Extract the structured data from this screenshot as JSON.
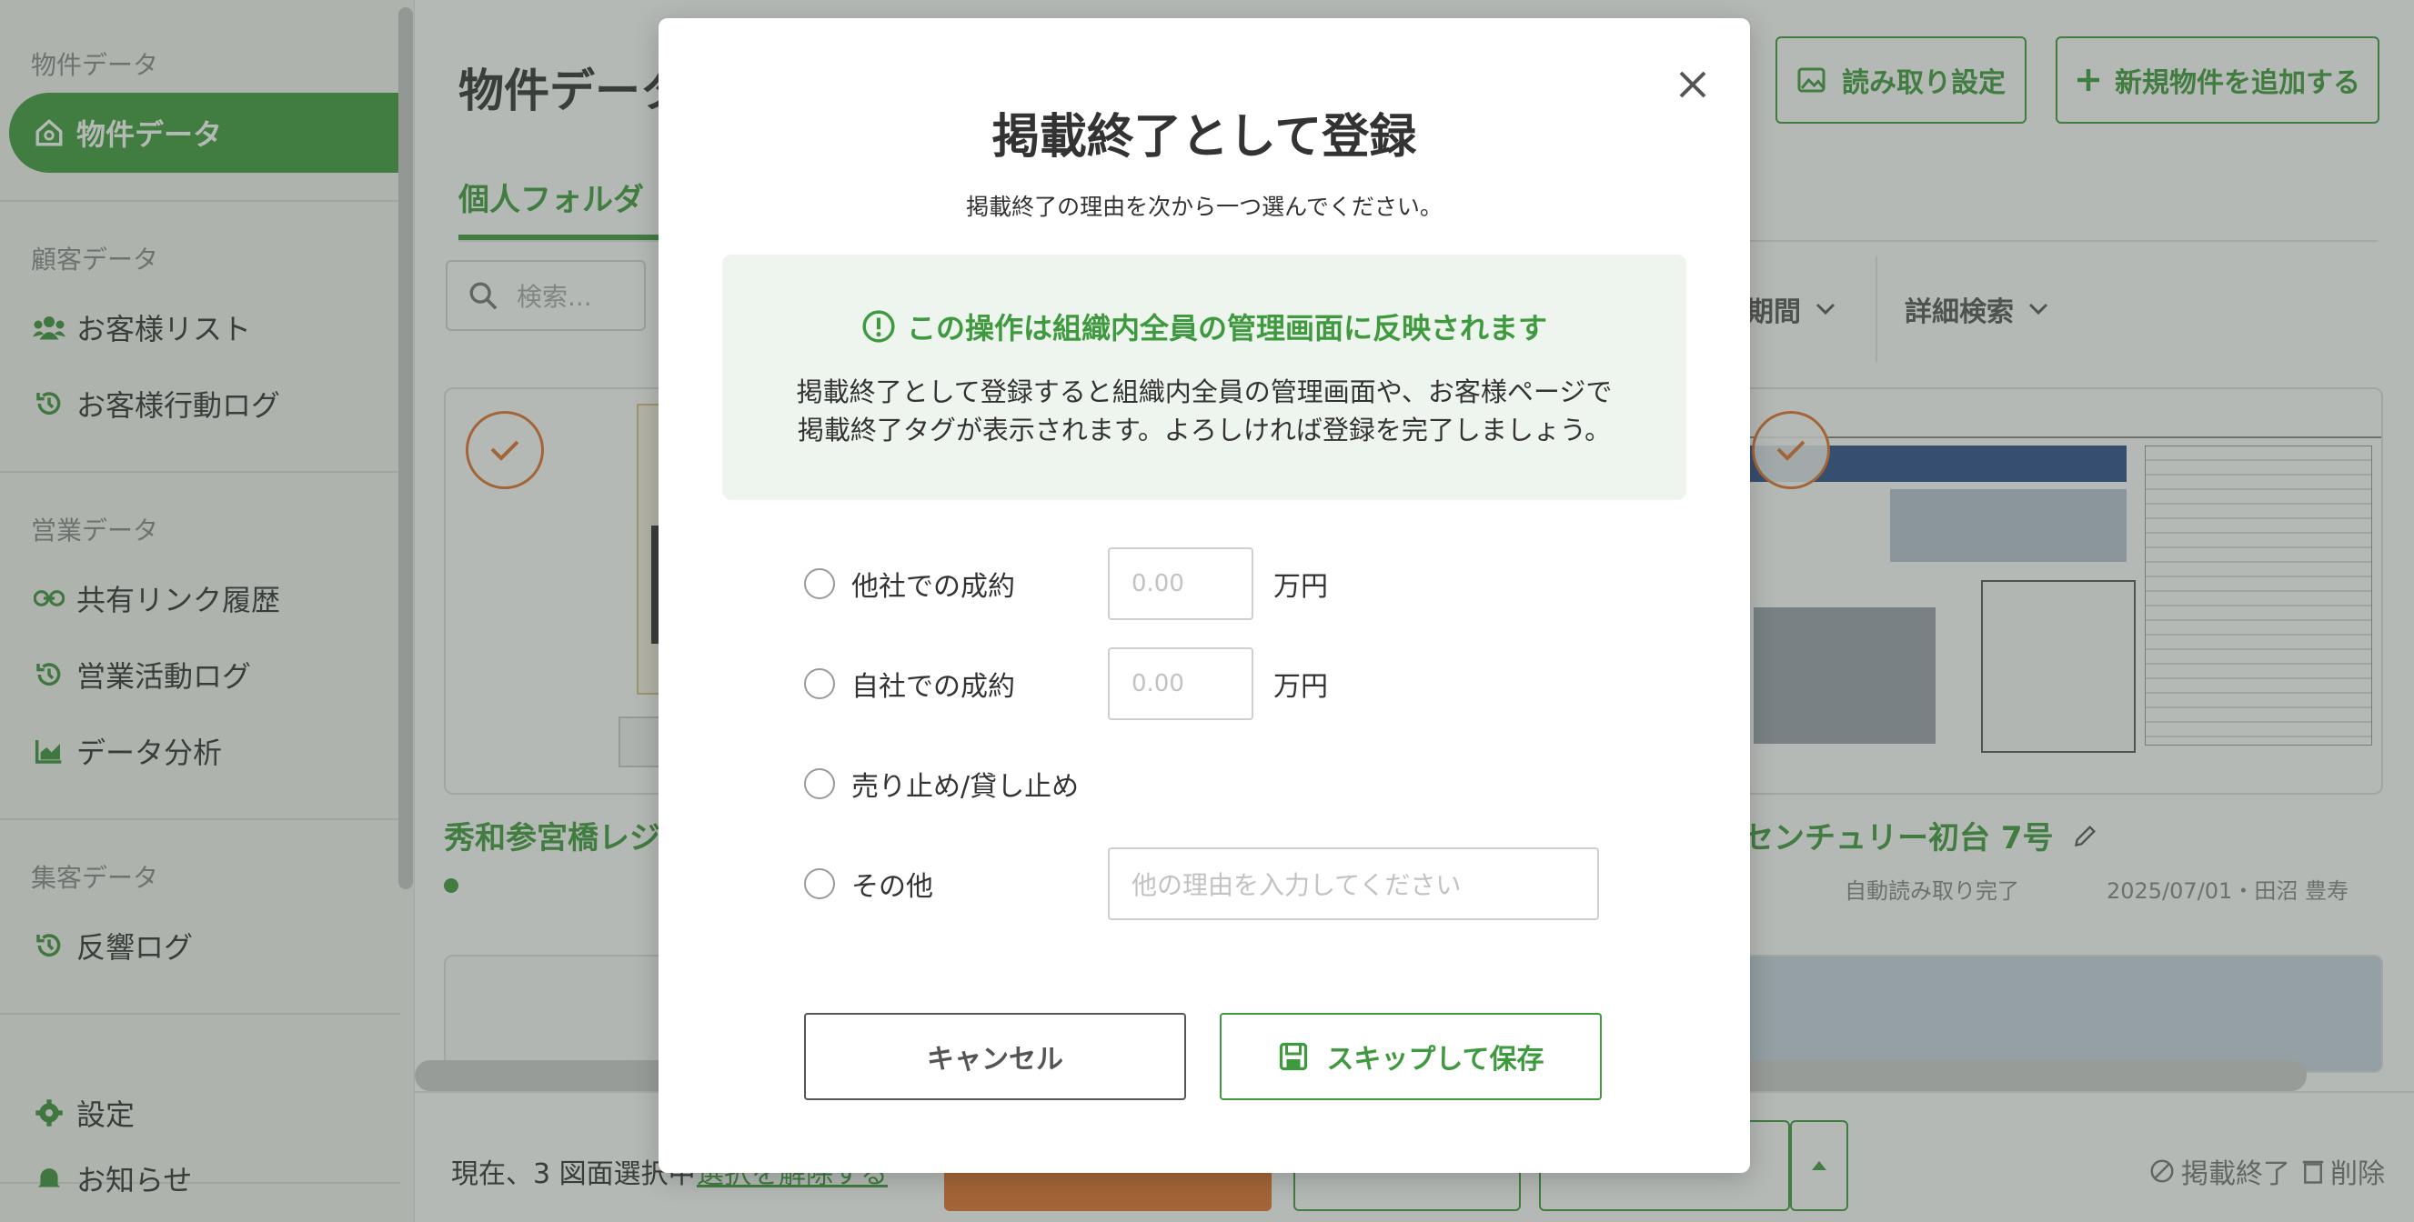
{
  "sidebar": {
    "section_property": "物件データ",
    "item_property": "物件データ",
    "section_customer": "顧客データ",
    "item_customer_list": "お客様リスト",
    "item_customer_log": "お客様行動ログ",
    "section_sales": "営業データ",
    "item_share_history": "共有リンク履歴",
    "item_sales_log": "営業活動ログ",
    "item_analysis": "データ分析",
    "section_attract": "集客データ",
    "item_response_log": "反響ログ",
    "item_settings": "設定",
    "item_notice": "お知らせ"
  },
  "header": {
    "title": "物件データ",
    "read_settings": "読み取り設定",
    "add_property": "新規物件を追加する"
  },
  "tabs": {
    "personal": "個人フォルダ"
  },
  "search": {
    "placeholder": "検索..."
  },
  "filters": {
    "period": "期間",
    "advanced": "詳細検索"
  },
  "cards": {
    "left_title": "秀和参宮橋レジデ",
    "right_title": "センチュリー初台 7号",
    "right_status": "自動読み取り完了",
    "right_date": "2025/07/01・田沼 豊寿"
  },
  "bottom": {
    "selected_text": "現在、3 図面選択中",
    "deselect": "選択を解除する",
    "end_listing": "掲載終了",
    "delete": "削除"
  },
  "modal": {
    "title": "掲載終了として登録",
    "subtitle": "掲載終了の理由を次から一つ選んでください。",
    "notice_heading": "この操作は組織内全員の管理画面に反映されます",
    "notice_body": "掲載終了として登録すると組織内全員の管理画面や、お客様ページで掲載終了タグが表示されます。よろしければ登録を完了しましょう。",
    "options": [
      {
        "label": "他社での成約",
        "placeholder": "0.00",
        "unit": "万円"
      },
      {
        "label": "自社での成約",
        "placeholder": "0.00",
        "unit": "万円"
      },
      {
        "label": "売り止め/貸し止め"
      },
      {
        "label": "その他",
        "placeholder": "他の理由を入力してください"
      }
    ],
    "cancel": "キャンセル",
    "skip_save": "スキップして保存"
  },
  "colors": {
    "brand": "#3f9a3f",
    "accent": "#e2742f"
  }
}
